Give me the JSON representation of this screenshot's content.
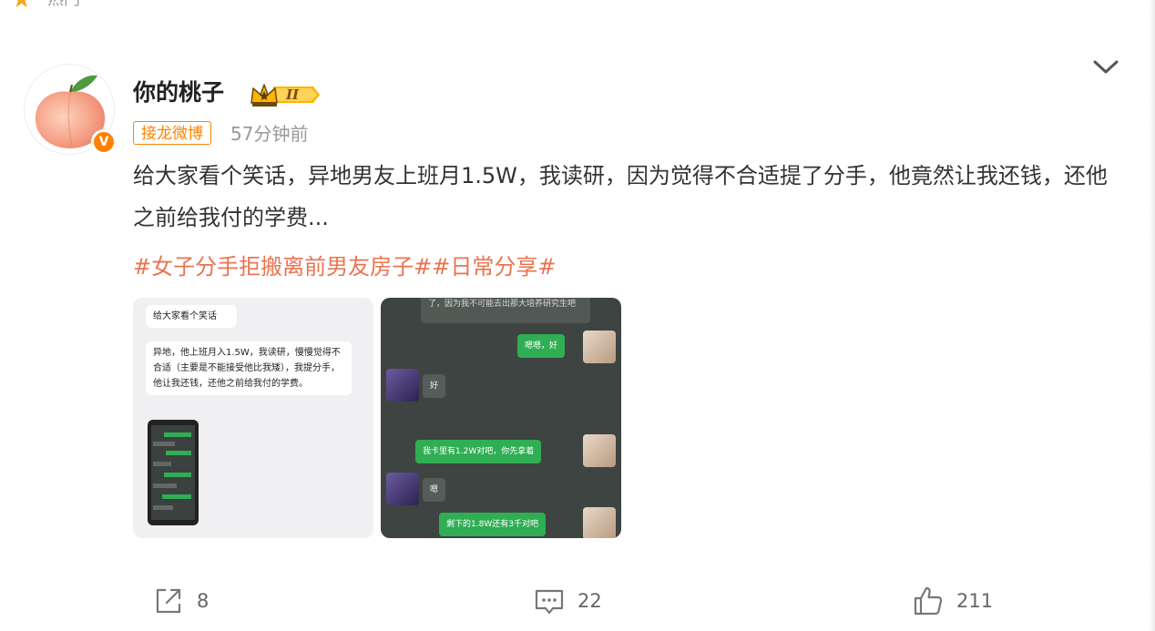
{
  "top_bar": {
    "label": "热门",
    "icon": "star-icon"
  },
  "post": {
    "author": {
      "name": "你的桃子",
      "verified_badge": "V",
      "member_level": "II"
    },
    "source": "接龙微博",
    "time": "57分钟前",
    "text": "给大家看个笑话，异地男友上班月1.5W，我读研，因为觉得不合适提了分手，他竟然让我还钱，还他之前给我付的学费...",
    "topics": [
      "#女子分手拒搬离前男友房子#",
      "#日常分享#"
    ]
  },
  "image1": {
    "bubble1": "给大家看个笑话",
    "bubble2": "异地，他上班月入1.5W，我读研，慢慢觉得不合适（主要是不能接受他比我矮），我提分手，他让我还钱，还他之前给我付的学费。"
  },
  "image2": {
    "top_bubble": "了，因为我不可能去出那大培养研究生吧",
    "msg1": "嗯嗯，好",
    "msg2": "好",
    "msg3": "我卡里有1.2W对吧，你先拿着",
    "msg4": "嗯",
    "msg5": "剩下的1.8W还有3千对吧"
  },
  "actions": {
    "repost_count": "8",
    "comment_count": "22",
    "like_count": "211"
  },
  "colors": {
    "accent_orange": "#ff8200",
    "topic": "#eb7350",
    "muted": "#999999",
    "wechat_green": "#2fae53"
  }
}
